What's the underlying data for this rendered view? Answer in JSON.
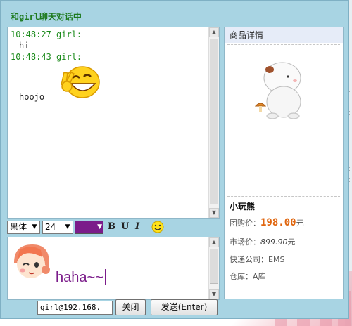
{
  "window": {
    "title": "和girl聊天对话中"
  },
  "chat": {
    "messages": [
      {
        "header": "10:48:27 girl:",
        "text": "hi"
      },
      {
        "header": "10:48:43 girl:",
        "text": "hoojo",
        "emoticon": "victory-smiley"
      }
    ]
  },
  "toolbar": {
    "font_family": "黑体",
    "font_size": "24",
    "text_color": "#7b1c8a",
    "bold_label": "B",
    "underline_label": "U",
    "italic_label": "I"
  },
  "input": {
    "text": "haha~~",
    "avatar": "cartoon-girl-wink"
  },
  "footer": {
    "address": "girl@192.168.",
    "close_label": "关闭",
    "send_label": "发送(Enter)"
  },
  "product": {
    "header": "商品详情",
    "image": "white-bear-toy",
    "name": "小玩熊",
    "group_price_label": "团购价：",
    "group_price": "198.00",
    "group_price_unit": "元",
    "market_price_label": "市场价：",
    "market_price": "899.90",
    "market_price_unit": "元",
    "courier_label": "快递公司：",
    "courier": "EMS",
    "warehouse_label": "仓库：",
    "warehouse": "A库"
  },
  "colors": {
    "accent_green": "#1e7a1e",
    "window_bg": "#a8d4e3",
    "price_orange": "#e0660f"
  }
}
